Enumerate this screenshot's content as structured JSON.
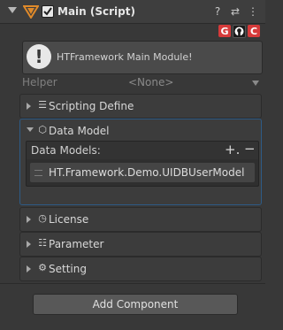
{
  "component": {
    "title": "Main (Script)",
    "header_icons": [
      "help-icon",
      "preset-icon",
      "more-icon"
    ],
    "header_icon_glyphs": [
      "?",
      "⇄",
      "⋮"
    ],
    "badges": [
      {
        "name": "gitee-badge",
        "label": "G",
        "color": "#d63a3a"
      },
      {
        "name": "github-badge",
        "label": "",
        "color": "#1a1a1a"
      },
      {
        "name": "csdn-badge",
        "label": "C",
        "color": "#d63a3a"
      }
    ]
  },
  "info": {
    "message": "HTFramework Main Module!"
  },
  "helper": {
    "label": "Helper",
    "value": "<None>"
  },
  "sections": {
    "scripting_define": {
      "label": "Scripting Define",
      "icon": "list-icon"
    },
    "data_model": {
      "label": "Data Model",
      "icon": "cube-icon"
    },
    "license": {
      "label": "License",
      "icon": "clock-icon"
    },
    "parameter": {
      "label": "Parameter",
      "icon": "bullet-list-icon"
    },
    "setting": {
      "label": "Setting",
      "icon": "gear-icon"
    }
  },
  "data_models": {
    "header": "Data Models:",
    "add": "+.",
    "remove": "−",
    "items": [
      "HT.Framework.Demo.UIDBUserModel"
    ]
  },
  "add_component": "Add Component"
}
